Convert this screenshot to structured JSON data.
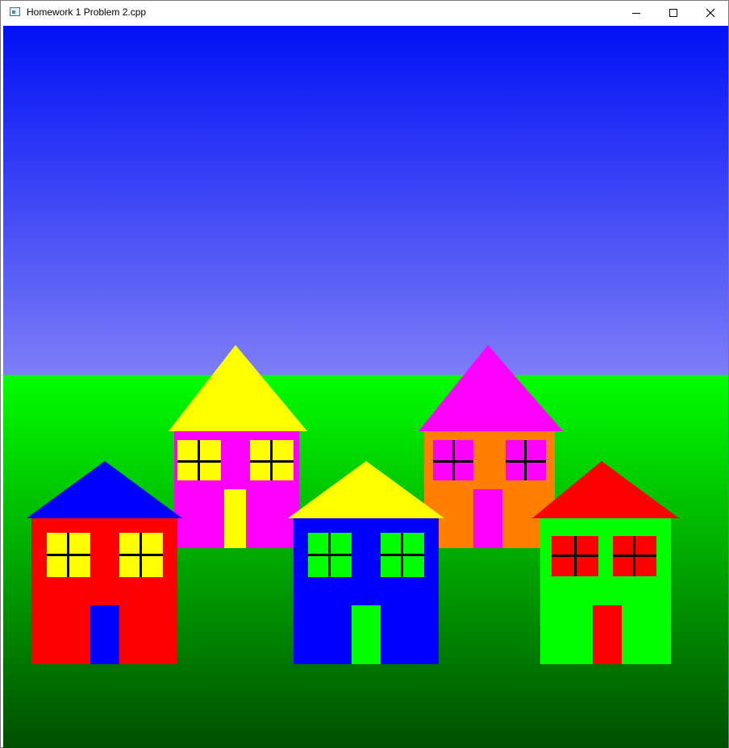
{
  "window": {
    "title": "Homework 1 Problem 2.cpp",
    "controls": [
      "minimize-icon",
      "maximize-icon",
      "close-icon"
    ]
  },
  "scene": {
    "sky_colors": [
      "#0011f5",
      "#7d7df7"
    ],
    "grass_colors": [
      "#00ff00",
      "#004f00"
    ],
    "window_pane_color": "#000000",
    "houses": [
      {
        "name": "magenta-house",
        "body": "#ff00ff",
        "roof": "#ffff00",
        "windows": "#ffff00",
        "door": "#ffff00"
      },
      {
        "name": "orange-house",
        "body": "#ff7f00",
        "roof": "#ff00ff",
        "windows": "#ff00ff",
        "door": "#ff00ff"
      },
      {
        "name": "red-house",
        "body": "#ff0000",
        "roof": "#0000ff",
        "windows": "#ffff00",
        "door": "#0000ff"
      },
      {
        "name": "blue-house",
        "body": "#0000ff",
        "roof": "#ffff00",
        "windows": "#00ff00",
        "door": "#00ff00"
      },
      {
        "name": "green-house",
        "body": "#00ff00",
        "roof": "#ff0000",
        "windows": "#ff0000",
        "door": "#ff0000"
      }
    ]
  }
}
